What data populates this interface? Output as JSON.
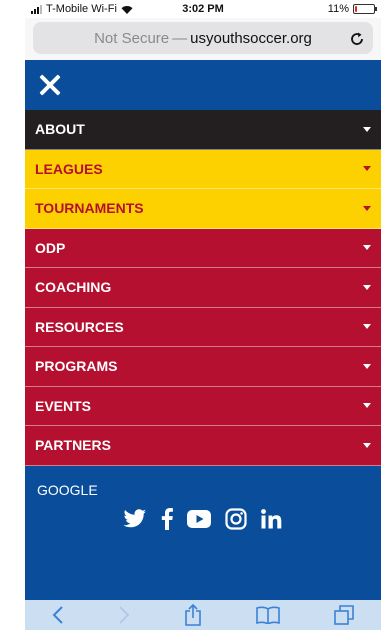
{
  "status": {
    "carrier": "T-Mobile Wi-Fi",
    "time": "3:02 PM",
    "battery": "11%",
    "battery_level": 0.11
  },
  "address": {
    "secure_text": "Not Secure",
    "separator": "—",
    "domain": "usyouthsoccer.org"
  },
  "menu": {
    "items": [
      {
        "label": "ABOUT",
        "bg": "#231f20",
        "caret": "#ffffff",
        "text": "#ffffff"
      },
      {
        "label": "LEAGUES",
        "bg": "#fdd000",
        "caret": "#b5102f",
        "text": "#b5102f"
      },
      {
        "label": "TOURNAMENTS",
        "bg": "#fdd000",
        "caret": "#b5102f",
        "text": "#b5102f"
      },
      {
        "label": "ODP",
        "bg": "#b5102f",
        "caret": "#ffffff",
        "text": "#ffffff"
      },
      {
        "label": "COACHING",
        "bg": "#b5102f",
        "caret": "#ffffff",
        "text": "#ffffff"
      },
      {
        "label": "RESOURCES",
        "bg": "#b5102f",
        "caret": "#ffffff",
        "text": "#ffffff"
      },
      {
        "label": "PROGRAMS",
        "bg": "#b5102f",
        "caret": "#ffffff",
        "text": "#ffffff"
      },
      {
        "label": "EVENTS",
        "bg": "#b5102f",
        "caret": "#ffffff",
        "text": "#ffffff"
      },
      {
        "label": "PARTNERS",
        "bg": "#b5102f",
        "caret": "#ffffff",
        "text": "#ffffff"
      }
    ],
    "google": "GOOGLE",
    "social": [
      "twitter-icon",
      "facebook-icon",
      "youtube-icon",
      "instagram-icon",
      "linkedin-icon"
    ]
  },
  "colors": {
    "menu_bg": "#0a4e9b",
    "toolbar_bg": "#ccdff2",
    "toolbar_icon": "#3b82d6"
  },
  "toolbar": [
    "back-icon",
    "forward-icon",
    "share-icon",
    "bookmarks-icon",
    "tabs-icon"
  ]
}
